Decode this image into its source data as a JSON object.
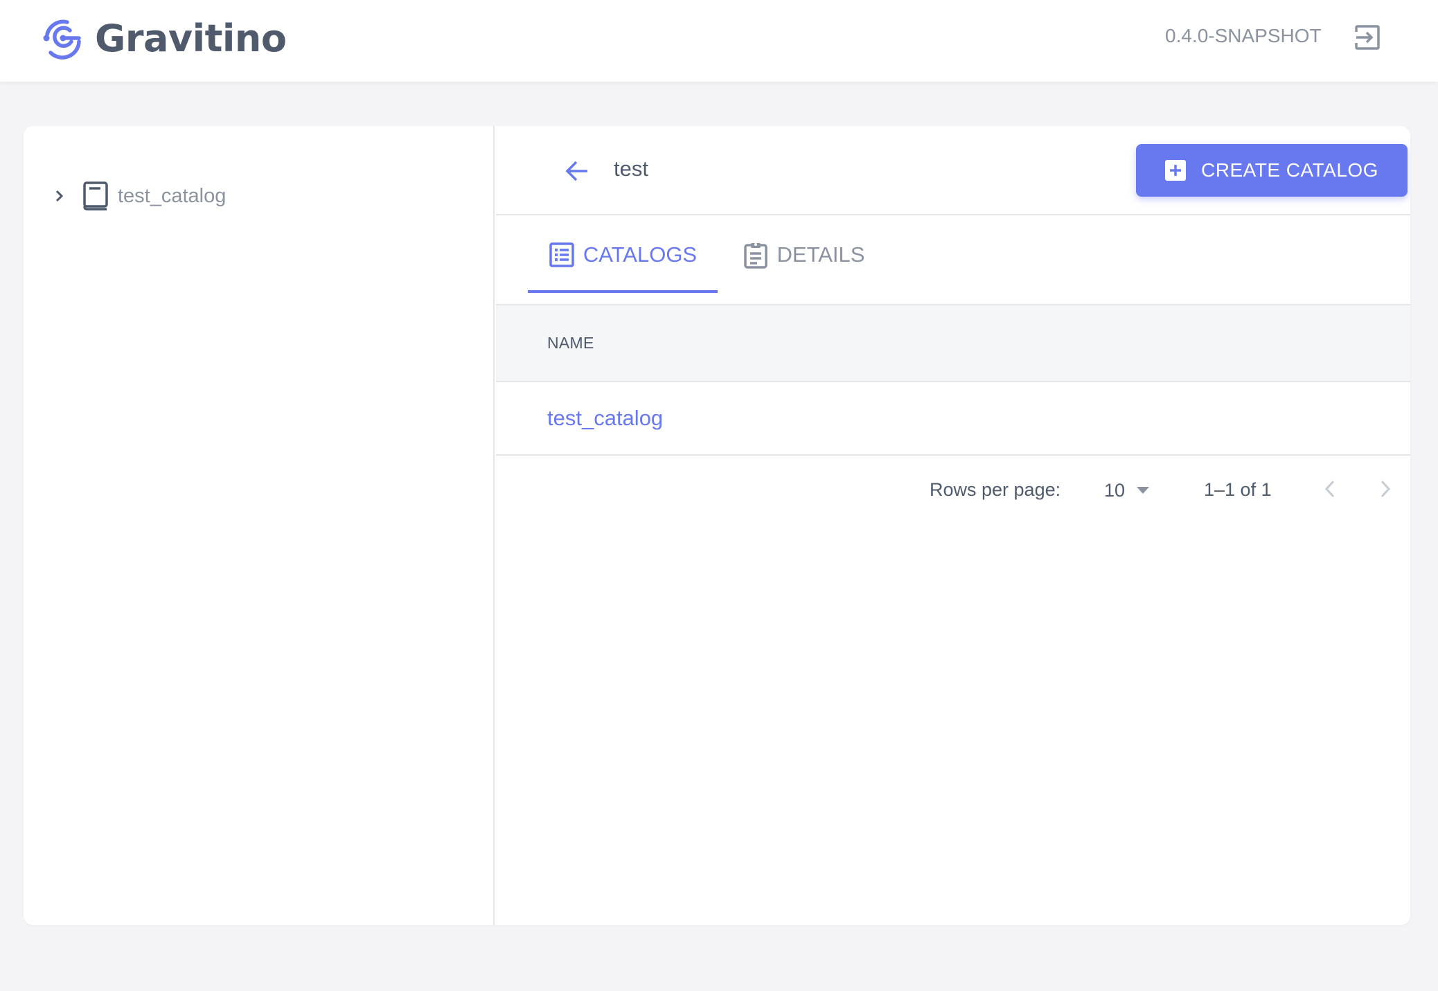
{
  "app": {
    "name": "Gravitino",
    "version": "0.4.0-SNAPSHOT",
    "logout_icon": "logout-icon"
  },
  "colors": {
    "accent": "#6878ef",
    "text_primary": "#4f5b6c",
    "text_muted": "#8a939f",
    "background": "#f4f4f6",
    "border": "#e6e6ea"
  },
  "sidebar": {
    "tree": [
      {
        "label": "test_catalog",
        "icon": "book-icon",
        "expanded": false
      }
    ]
  },
  "main": {
    "metalake_name": "test",
    "back_icon": "arrow-left-icon",
    "create_button": {
      "label": "CREATE CATALOG",
      "icon": "plus-box-icon"
    },
    "tabs": [
      {
        "label": "CATALOGS",
        "icon": "list-icon",
        "active": true
      },
      {
        "label": "DETAILS",
        "icon": "clipboard-icon",
        "active": false
      }
    ],
    "table": {
      "columns": [
        "NAME"
      ],
      "rows": [
        {
          "name": "test_catalog"
        }
      ]
    },
    "pagination": {
      "rows_per_page_label": "Rows per page:",
      "rows_per_page": "10",
      "range": "1–1 of 1"
    }
  }
}
